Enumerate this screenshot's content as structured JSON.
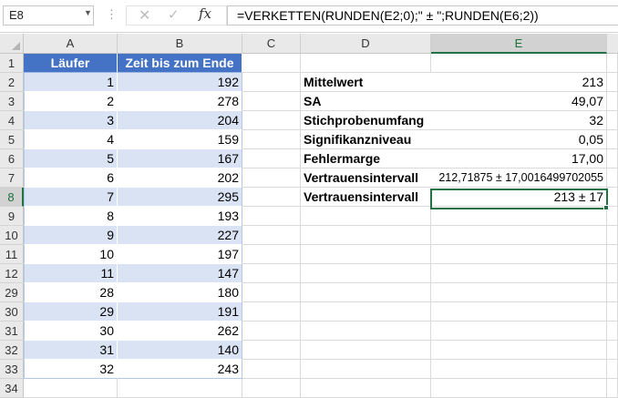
{
  "name_box": "E8",
  "formula": "=VERKETTEN(RUNDEN(E2;0);\" ± \";RUNDEN(E6;2))",
  "columns": [
    "A",
    "B",
    "C",
    "D",
    "E"
  ],
  "rows": [
    "1",
    "2",
    "3",
    "4",
    "5",
    "6",
    "7",
    "8",
    "9",
    "10",
    "11",
    "12",
    "29",
    "30",
    "31",
    "32",
    "33",
    "34"
  ],
  "table": {
    "header_a": "Läufer",
    "header_b": "Zeit bis zum Ende",
    "runners": [
      "1",
      "2",
      "3",
      "4",
      "5",
      "6",
      "7",
      "8",
      "9",
      "10",
      "11",
      "28",
      "29",
      "30",
      "31",
      "32"
    ],
    "times": [
      "192",
      "278",
      "204",
      "159",
      "167",
      "202",
      "295",
      "193",
      "227",
      "197",
      "147",
      "180",
      "191",
      "262",
      "140",
      "243"
    ]
  },
  "stats": {
    "labels": [
      "Mittelwert",
      "SA",
      "Stichprobenumfang",
      "Signifikanzniveau",
      "Fehlermarge",
      "Vertrauensintervall",
      "Vertrauensintervall"
    ],
    "values": [
      "213",
      "49,07",
      "32",
      "0,05",
      "17,00",
      "212,71875 ± 17,0016499702055",
      "213 ± 17"
    ]
  },
  "selected_cell": "E8",
  "accent_color": "#217346",
  "table_header_color": "#4472c4",
  "table_band_color": "#dae3f3"
}
